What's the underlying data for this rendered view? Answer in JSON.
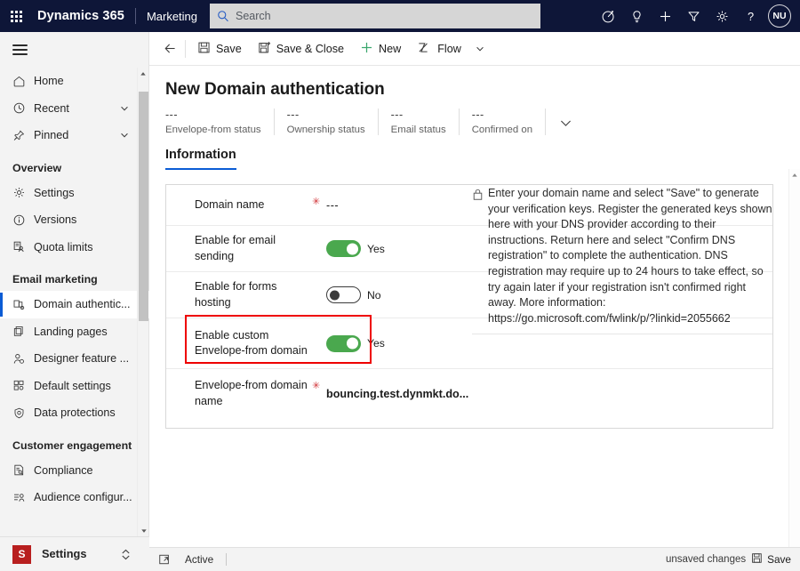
{
  "suite": {
    "waffle_icon": "waffle-icon",
    "brand": "Dynamics 365",
    "app_name": "Marketing",
    "search": {
      "placeholder": "Search",
      "icon": "search-icon"
    },
    "icons": [
      "assistant-target-icon",
      "lightbulb-icon",
      "plus-icon",
      "filter-icon",
      "gear-icon",
      "help-icon"
    ],
    "avatar_initials": "NU",
    "accent": "#0e1638"
  },
  "sidebar": {
    "hamburger_icon": "hamburger-icon",
    "items": [
      {
        "label": "Home",
        "icon": "home-icon",
        "chevron": false,
        "selected": false
      },
      {
        "label": "Recent",
        "icon": "clock-icon",
        "chevron": true,
        "selected": false
      },
      {
        "label": "Pinned",
        "icon": "pin-icon",
        "chevron": true,
        "selected": false
      }
    ],
    "groups": [
      {
        "title": "Overview",
        "items": [
          {
            "label": "Settings",
            "icon": "gear-icon",
            "selected": false
          },
          {
            "label": "Versions",
            "icon": "info-circle-icon",
            "selected": false
          },
          {
            "label": "Quota limits",
            "icon": "quota-icon",
            "selected": false
          }
        ]
      },
      {
        "title": "Email marketing",
        "items": [
          {
            "label": "Domain authentic...",
            "icon": "domain-auth-icon",
            "selected": true
          },
          {
            "label": "Landing pages",
            "icon": "pages-icon",
            "selected": false
          },
          {
            "label": "Designer feature ...",
            "icon": "person-gear-icon",
            "selected": false
          },
          {
            "label": "Default settings",
            "icon": "default-settings-icon",
            "selected": false
          },
          {
            "label": "Data protections",
            "icon": "shield-icon",
            "selected": false
          }
        ]
      },
      {
        "title": "Customer engagement",
        "items": [
          {
            "label": "Compliance",
            "icon": "compliance-icon",
            "selected": false
          },
          {
            "label": "Audience configur...",
            "icon": "audience-icon",
            "selected": false
          }
        ]
      }
    ],
    "footer": {
      "badge": "S",
      "label": "Settings",
      "badge_color": "#b81f1f",
      "selector_icon": "diamond-chevron-icon"
    }
  },
  "commandbar": {
    "back_icon": "back-arrow-icon",
    "buttons": [
      {
        "label": "Save",
        "icon": "save-icon"
      },
      {
        "label": "Save & Close",
        "icon": "save-close-icon"
      },
      {
        "label": "New",
        "icon": "plus-icon"
      },
      {
        "label": "Flow",
        "icon": "flow-icon"
      }
    ],
    "overflow_icon": "chevron-down-icon"
  },
  "page": {
    "title": "New Domain authentication",
    "header_fields": [
      {
        "value": "---",
        "label": "Envelope-from status"
      },
      {
        "value": "---",
        "label": "Ownership status"
      },
      {
        "value": "---",
        "label": "Email status"
      },
      {
        "value": "---",
        "label": "Confirmed on"
      }
    ],
    "header_expand_icon": "chevron-down-icon",
    "tabs": [
      {
        "label": "Information",
        "active": true
      }
    ]
  },
  "form": {
    "rows": [
      {
        "label": "Domain name",
        "required": true,
        "type": "text",
        "value": "---"
      },
      {
        "label": "Enable for email sending",
        "required": false,
        "type": "toggle",
        "state": "on",
        "state_label": "Yes"
      },
      {
        "label": "Enable for forms hosting",
        "required": false,
        "type": "toggle",
        "state": "off",
        "state_label": "No"
      },
      {
        "label": "Enable custom Envelope-from domain",
        "required": false,
        "type": "toggle",
        "state": "on",
        "state_label": "Yes"
      },
      {
        "label": "Envelope-from domain name",
        "required": true,
        "type": "text",
        "value": "bouncing.test.dynmkt.do...",
        "bold": true
      }
    ],
    "highlight_color": "#ee0000",
    "toggle_on_color": "#4aa84e"
  },
  "info_panel": {
    "icon": "lock-icon",
    "text": "Enter your domain name and select \"Save\" to generate your verification keys. Register the generated keys shown here with your DNS provider according to their instructions. Return here and select \"Confirm DNS registration\" to complete the authentication. DNS registration may require up to 24 hours to take effect, so try again later if your registration isn't confirmed right away. More information: https://go.microsoft.com/fwlink/p/?linkid=2055662"
  },
  "statusbar": {
    "expand_icon": "expand-icon",
    "state": "Active",
    "unsaved": "unsaved changes",
    "save_label": "Save",
    "save_icon": "save-icon"
  }
}
